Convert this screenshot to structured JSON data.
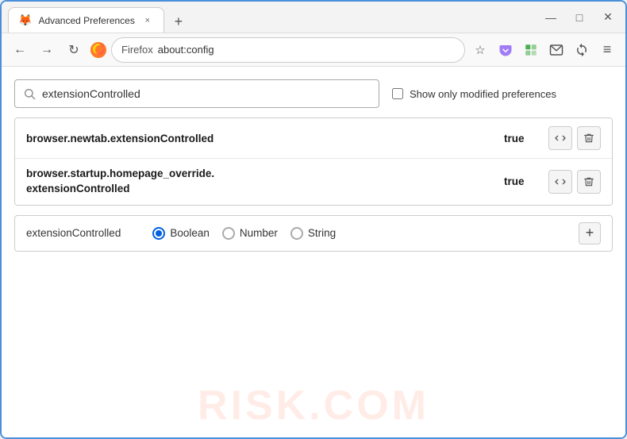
{
  "window": {
    "title": "Advanced Preferences",
    "tab_close_label": "×",
    "new_tab_label": "+",
    "minimize_label": "—",
    "maximize_label": "□",
    "close_label": "✕"
  },
  "nav": {
    "back_label": "←",
    "forward_label": "→",
    "reload_label": "↻",
    "brand": "Firefox",
    "url": "about:config",
    "bookmark_icon": "☆",
    "pocket_icon": "⛉",
    "extension_icon": "⊞",
    "download_icon": "⬇",
    "sync_icon": "↻",
    "menu_icon": "≡"
  },
  "search": {
    "placeholder": "extensionControlled",
    "value": "extensionControlled",
    "show_modified_label": "Show only modified preferences"
  },
  "results": [
    {
      "name": "browser.newtab.extensionControlled",
      "value": "true",
      "toggle_label": "⇄",
      "delete_label": "🗑"
    },
    {
      "name": "browser.startup.homepage_override.\nextensionControlled",
      "name_line1": "browser.startup.homepage_override.",
      "name_line2": "extensionControlled",
      "value": "true",
      "toggle_label": "⇄",
      "delete_label": "🗑"
    }
  ],
  "new_pref": {
    "name": "extensionControlled",
    "types": [
      {
        "label": "Boolean",
        "selected": true
      },
      {
        "label": "Number",
        "selected": false
      },
      {
        "label": "String",
        "selected": false
      }
    ],
    "add_label": "+"
  },
  "watermark": "RISK.COM"
}
